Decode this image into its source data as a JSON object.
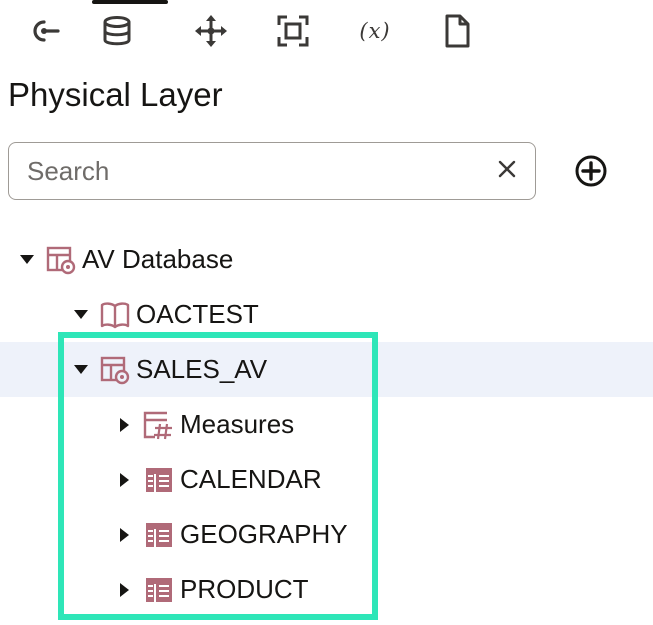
{
  "toolbar": {
    "items": [
      {
        "icon": "connect-icon"
      },
      {
        "icon": "database-icon",
        "active": true
      },
      {
        "icon": "move-icon"
      },
      {
        "icon": "fit-frame-icon"
      },
      {
        "icon": "variable-icon",
        "text": "(x)"
      },
      {
        "icon": "document-icon"
      }
    ]
  },
  "panel": {
    "title": "Physical Layer"
  },
  "search": {
    "placeholder": "Search",
    "value": "",
    "clear_icon": "close-icon",
    "add_icon": "add-circle-icon"
  },
  "tree": {
    "nodes": [
      {
        "label": "AV Database",
        "level": 0,
        "expanded": true,
        "icon": "database-connection-icon"
      },
      {
        "label": "OACTEST",
        "level": 1,
        "expanded": true,
        "icon": "schema-book-icon"
      },
      {
        "label": "SALES_AV",
        "level": 2,
        "expanded": true,
        "icon": "analytic-view-icon",
        "selected": true
      },
      {
        "label": "Measures",
        "level": 3,
        "expanded": false,
        "icon": "measures-table-icon"
      },
      {
        "label": "CALENDAR",
        "level": 3,
        "expanded": false,
        "icon": "table-icon"
      },
      {
        "label": "GEOGRAPHY",
        "level": 3,
        "expanded": false,
        "icon": "table-icon"
      },
      {
        "label": "PRODUCT",
        "level": 3,
        "expanded": false,
        "icon": "table-icon"
      }
    ]
  },
  "colors": {
    "accent_highlight": "#2ee6b8",
    "node_icon": "#b06a78",
    "selected_row": "#eef2fa",
    "text": "#161513"
  }
}
